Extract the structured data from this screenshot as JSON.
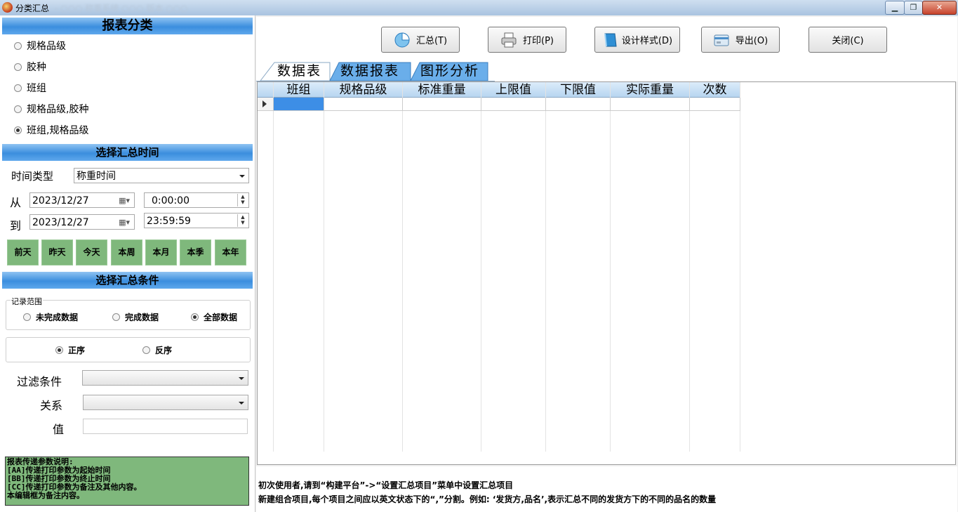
{
  "window": {
    "title": "分类汇总",
    "title_extra": "- ○○○ 称重系统 ○○○ 版本 ○○○"
  },
  "left": {
    "report_category": {
      "header": "报表分类",
      "options": [
        "规格品级",
        "胶种",
        "班组",
        "规格品级,胶种",
        "班组,规格品级"
      ],
      "selected_index": 4
    },
    "time": {
      "header": "选择汇总时间",
      "type_label": "时间类型",
      "type_value": "称重时间",
      "from_label": "从",
      "to_label": "到",
      "from_date": "2023/12/27",
      "from_time": "0:00:00",
      "to_date": "2023/12/27",
      "to_time": "23:59:59",
      "quick_buttons": [
        "前天",
        "昨天",
        "今天",
        "本周",
        "本月",
        "本季",
        "本年"
      ]
    },
    "conditions": {
      "header": "选择汇总条件",
      "record_range_label": "记录范围",
      "record_options": [
        "未完成数据",
        "完成数据",
        "全部数据"
      ],
      "record_selected": 2,
      "order_options": [
        "正序",
        "反序"
      ],
      "order_selected": 0,
      "filter_label": "过滤条件",
      "relation_label": "关系",
      "value_label": "值",
      "filter_value": "",
      "relation_value": "",
      "value_value": ""
    },
    "note_lines": [
      "报表传递参数说明:",
      "[AA]传递打印参数为起始时间",
      "[BB]传递打印参数为终止时间",
      "[CC]传递打印参数为备注及其他内容。",
      "本编辑框为备注内容。"
    ]
  },
  "toolbar": {
    "summary": "汇总(T)",
    "print": "打印(P)",
    "design": "设计样式(D)",
    "export": "导出(O)",
    "close": "关闭(C)"
  },
  "tabs": [
    "数据表",
    "数据报表",
    "图形分析"
  ],
  "active_tab": 0,
  "grid": {
    "columns": [
      "班组",
      "规格品级",
      "标准重量",
      "上限值",
      "下限值",
      "实际重量",
      "次数"
    ]
  },
  "info": {
    "line1": "初次使用者,请到“构建平台”->“设置汇总项目”菜单中设置汇总项目",
    "line2": "新建组合项目,每个项目之间应以英文状态下的“,”分割。例如: ‘发货方,品名’,表示汇总不同的发货方下的不同的品名的数量"
  },
  "colors": {
    "header_blue": "#3b8ede",
    "quick_green": "#7fb87c",
    "selected_cell": "#3d8ee6"
  }
}
